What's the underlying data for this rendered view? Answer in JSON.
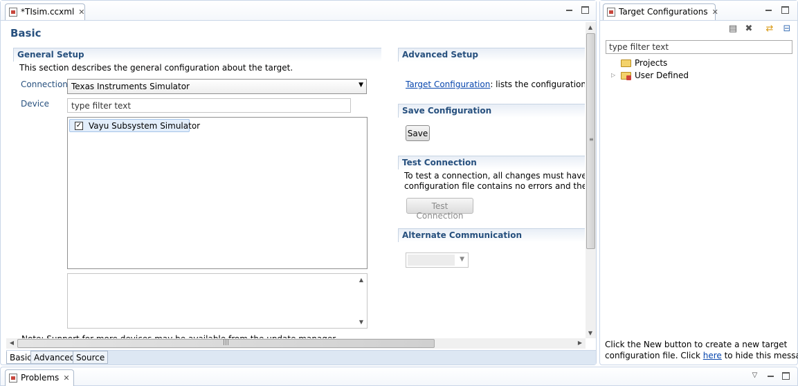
{
  "editor": {
    "tab_title": "*TIsim.ccxml",
    "page_title": "Basic",
    "general_setup": {
      "heading": "General Setup",
      "description": "This section describes the general configuration about the target.",
      "connection_label": "Connection",
      "connection_value": "Texas Instruments Simulator",
      "device_label": "Device",
      "device_filter_placeholder": "type filter text",
      "devices": [
        {
          "label": "Vayu Subsystem Simulator",
          "checked": true
        }
      ],
      "note": "Note: Support for more devices may be available from the update manager."
    },
    "advanced_setup": {
      "heading": "Advanced Setup",
      "link_text": "Target Configuration",
      "link_suffix": ": lists the configuration opti"
    },
    "save_configuration": {
      "heading": "Save Configuration",
      "button": "Save"
    },
    "test_connection": {
      "heading": "Test Connection",
      "line1": "To test a connection, all changes must have been",
      "line2": "configuration file contains no errors and the conn",
      "button": "Test Connection"
    },
    "alternate_communication": {
      "heading": "Alternate Communication",
      "select_value": ""
    },
    "bottom_tabs": [
      "Basic",
      "Advanced",
      "Source"
    ],
    "active_bottom_tab": "Basic"
  },
  "target_configurations": {
    "title": "Target Configurations",
    "filter_placeholder": "type filter text",
    "tree": [
      {
        "label": "Projects",
        "icon": "folder-open-icon"
      },
      {
        "label": "User Defined",
        "icon": "folder-config-icon",
        "expandable": true
      }
    ],
    "message_part1": "Click the New button to create a new target",
    "message_part2": "configuration file. Click ",
    "message_link": "here",
    "message_part3": " to hide this message."
  },
  "problems": {
    "title": "Problems"
  },
  "colors": {
    "heading_blue": "#27507e",
    "link_blue": "#0645ad",
    "border": "#c9d6e8"
  }
}
